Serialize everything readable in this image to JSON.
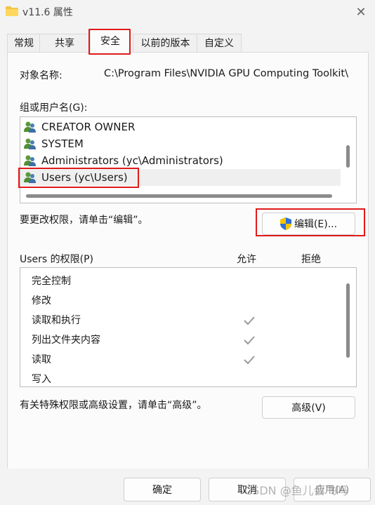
{
  "window": {
    "title": "v11.6 属性"
  },
  "tabs": [
    {
      "label": "常规"
    },
    {
      "label": "共享"
    },
    {
      "label": "安全"
    },
    {
      "label": "以前的版本"
    },
    {
      "label": "自定义"
    }
  ],
  "security": {
    "object_name_label": "对象名称:",
    "object_name_value": "C:\\Program Files\\NVIDIA GPU Computing Toolkit\\",
    "groups_label": "组或用户名(G):",
    "groups": [
      {
        "name": "CREATOR OWNER"
      },
      {
        "name": "SYSTEM"
      },
      {
        "name": "Administrators (yc\\Administrators)"
      },
      {
        "name": "Users (yc\\Users)",
        "selected": true
      }
    ],
    "change_hint": "要更改权限，请单击“编辑”。",
    "edit_button": "编辑(E)...",
    "permissions_label": "Users 的权限(P)",
    "allow_header": "允许",
    "deny_header": "拒绝",
    "permissions": [
      {
        "name": "完全控制",
        "allow": false
      },
      {
        "name": "修改",
        "allow": false
      },
      {
        "name": "读取和执行",
        "allow": true
      },
      {
        "name": "列出文件夹内容",
        "allow": true
      },
      {
        "name": "读取",
        "allow": true
      },
      {
        "name": "写入",
        "allow": false
      }
    ],
    "advanced_hint": "有关特殊权限或高级设置，请单击“高级”。",
    "advanced_button": "高级(V)"
  },
  "footer": {
    "ok_button": "确定",
    "cancel_button": "取消",
    "apply_button": "应用(A)"
  },
  "watermark": "CSDN @鱼儿会飞吗",
  "colors": {
    "highlight_red": "#e01a1a",
    "check_gray": "#9a9a9a"
  }
}
